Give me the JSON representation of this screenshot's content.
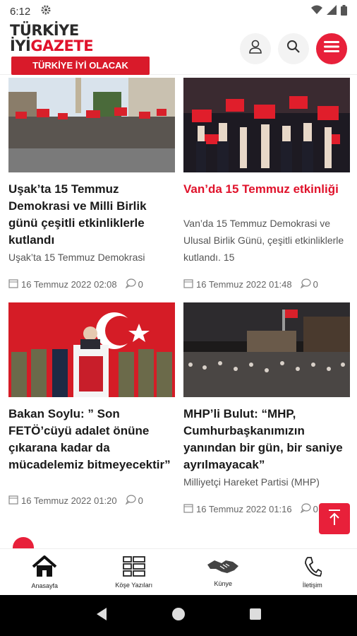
{
  "status_bar": {
    "time": "6:12"
  },
  "header": {
    "logo_main": "TÜRKİYE İYİ",
    "logo_accent": "GAZETE",
    "logo_tagline": "TÜRKİYE İYİ OLACAK"
  },
  "articles": [
    {
      "title": "Uşak’ta 15 Temmuz Demokrasi ve Milli Birlik günü çeşitli etkinliklerle kutlandı",
      "desc": "Uşak’ta 15 Temmuz Demokrasi",
      "date": "16 Temmuz 2022 02:08",
      "comments": "0"
    },
    {
      "title": "Van’da 15 Temmuz etkinliği",
      "desc": "Van’da 15 Temmuz Demokrasi ve Ulusal Birlik Günü, çeşitli etkinliklerle kutlandı. 15",
      "date": "16 Temmuz 2022 01:48",
      "comments": "0"
    },
    {
      "title": "Bakan Soylu: ” Son FETÖ’cüyü adalet önüne çıkarana kadar da mücadelemiz bitmeyecektir”",
      "desc": "",
      "date": "16 Temmuz 2022 01:20",
      "comments": "0"
    },
    {
      "title": "MHP’li Bulut: “MHP, Cumhurbaşkanımızın yanından bir gün, bir saniye ayrılmayacak”",
      "desc": "Milliyetçi Hareket Partisi (MHP)",
      "date": "16 Temmuz 2022 01:16",
      "comments": "0"
    }
  ],
  "bottom_nav": {
    "home": "Anasayfa",
    "columns": "Köşe Yazıları",
    "imprint": "Künye",
    "contact": "İletişim"
  },
  "colors": {
    "accent": "#e0122b",
    "fab": "#e8203a"
  }
}
